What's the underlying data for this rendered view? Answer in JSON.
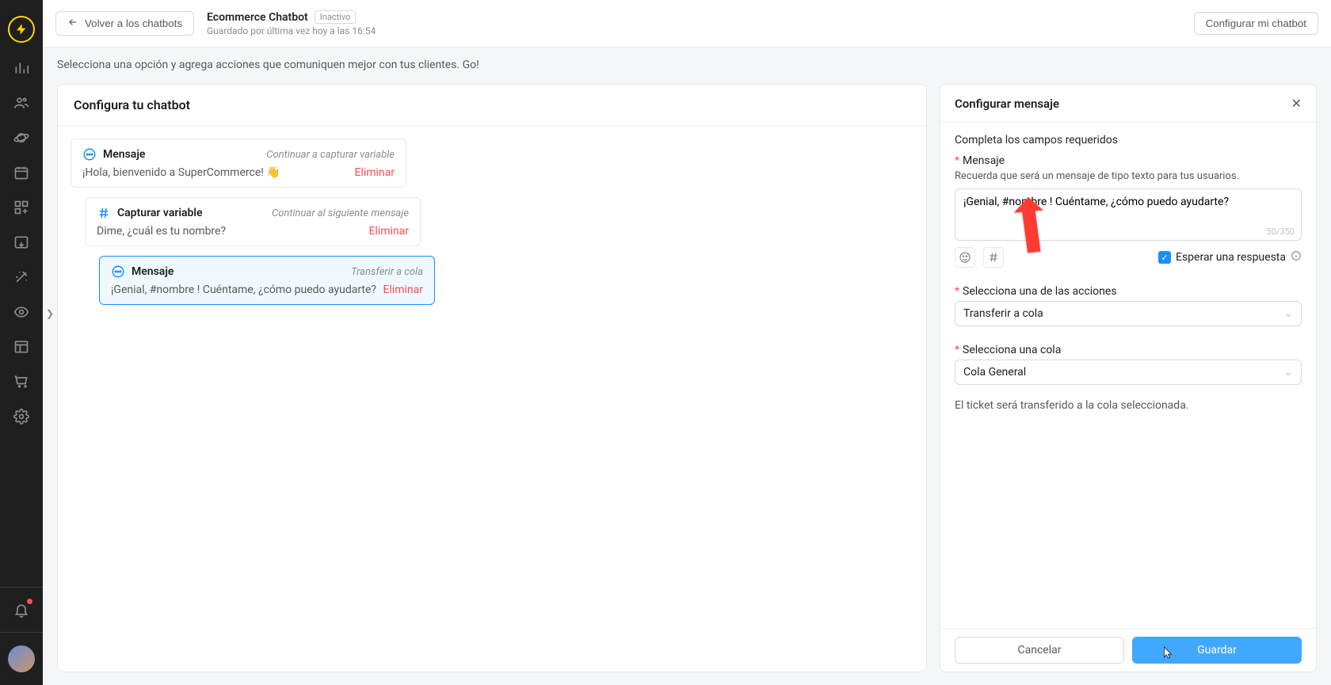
{
  "sidebar": {
    "active": "bolt"
  },
  "header": {
    "back_label": "Volver a los chatbots",
    "title": "Ecommerce Chatbot",
    "status": "Inactivo",
    "saved": "Guardado por última vez hoy a las 16:54",
    "config_btn": "Configurar mi chatbot"
  },
  "instruction": "Selecciona una opción y agrega acciones que comuniquen mejor con tus clientes. Go!",
  "left": {
    "title": "Configura tu chatbot",
    "nodes": [
      {
        "type": "Mensaje",
        "action": "Continuar a capturar variable",
        "text": "¡Hola, bienvenido a SuperCommerce! 👋",
        "delete": "Eliminar"
      },
      {
        "type": "Capturar variable",
        "action": "Continuar al siguiente mensaje",
        "text": "Dime, ¿cuál es tu nombre?",
        "delete": "Eliminar"
      },
      {
        "type": "Mensaje",
        "action": "Transferir a cola",
        "text": "¡Genial, #nombre ! Cuéntame, ¿cómo puedo ayudarte?",
        "delete": "Eliminar"
      }
    ]
  },
  "right": {
    "title": "Configurar mensaje",
    "required_note": "Completa los campos requeridos",
    "msg_label": "Mensaje",
    "msg_help": "Recuerda que será un mensaje de tipo texto para tus usuarios.",
    "msg_value": "¡Genial, #nombre ! Cuéntame, ¿cómo puedo ayudarte?",
    "counter": "50/350",
    "wait_label": "Esperar una respuesta",
    "action_label": "Selecciona una de las acciones",
    "action_value": "Transferir a cola",
    "queue_label": "Selecciona una cola",
    "queue_value": "Cola General",
    "transfer_note": "El ticket será transferido a la cola seleccionada.",
    "cancel": "Cancelar",
    "save": "Guardar"
  }
}
